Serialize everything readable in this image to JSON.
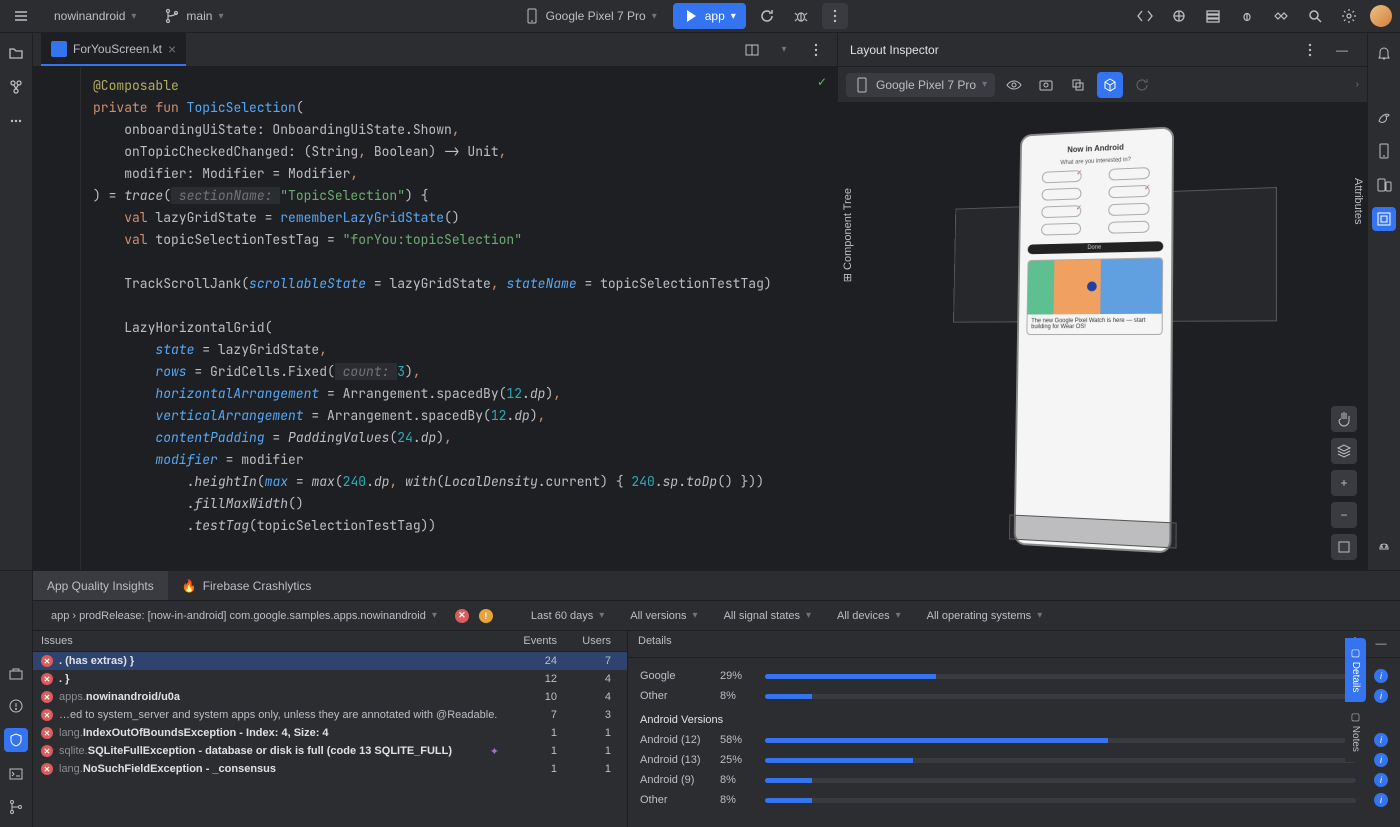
{
  "topbar": {
    "project": "nowinandroid",
    "branch": "main",
    "device": "Google Pixel 7 Pro",
    "run_config": "app"
  },
  "editor": {
    "tab_name": "ForYouScreen.kt",
    "code": {
      "l1": "@Composable",
      "l2a": "private",
      "l2b": "fun",
      "l2c": "TopicSelection",
      "l2d": "(",
      "l3a": "onboardingUiState",
      "l3b": ": OnboardingUiState.Shown",
      "l3c": ",",
      "l4a": "onTopicCheckedChanged",
      "l4b": ": (String",
      "l4c": ",",
      "l4d": " Boolean) -> Unit",
      "l4e": ",",
      "l5a": "modifier",
      "l5b": ": Modifier = Modifier",
      "l5c": ",",
      "l6a": ") = ",
      "l6b": "trace",
      "l6c": "(",
      "l6hint": " sectionName: ",
      "l6d": "\"TopicSelection\"",
      "l6e": ") {",
      "l7a": "val",
      "l7b": " lazyGridState = ",
      "l7c": "rememberLazyGridState",
      "l7d": "()",
      "l8a": "val",
      "l8b": " topicSelectionTestTag = ",
      "l8c": "\"forYou:topicSelection\"",
      "l10a": "TrackScrollJank(",
      "l10b": "scrollableState",
      "l10c": " = lazyGridState",
      "l10d": ",",
      "l10e": " stateName",
      "l10f": " = topicSelectionTestTag)",
      "l12a": "LazyHorizontalGrid(",
      "l13a": "state",
      "l13b": " = lazyGridState",
      "l13c": ",",
      "l14a": "rows",
      "l14b": " = GridCells.Fixed(",
      "l14hint": " count: ",
      "l14c": "3",
      "l14d": ")",
      "l14e": ",",
      "l15a": "horizontalArrangement",
      "l15b": " = Arrangement.spacedBy(",
      "l15c": "12",
      "l15d": ".",
      "l15e": "dp",
      "l15f": ")",
      "l15g": ",",
      "l16a": "verticalArrangement",
      "l16b": " = Arrangement.spacedBy(",
      "l16c": "12",
      "l16d": ".",
      "l16e": "dp",
      "l16f": ")",
      "l16g": ",",
      "l17a": "contentPadding",
      "l17b": " = ",
      "l17c": "PaddingValues",
      "l17d": "(",
      "l17e": "24",
      "l17f": ".",
      "l17g": "dp",
      "l17h": ")",
      "l17i": ",",
      "l18a": "modifier",
      "l18b": " = modifier",
      "l19a": ".",
      "l19b": "heightIn",
      "l19c": "(",
      "l19d": "max",
      "l19e": " = ",
      "l19f": "max",
      "l19g": "(",
      "l19h": "240",
      "l19i": ".",
      "l19j": "dp",
      "l19k": ",",
      "l19l": " with",
      "l19m": "(",
      "l19n": "LocalDensity",
      "l19o": ".current) { ",
      "l19p": "240",
      "l19q": ".",
      "l19r": "sp",
      "l19s": ".",
      "l19t": "toDp",
      "l19u": "() }))",
      "l20a": ".",
      "l20b": "fillMaxWidth",
      "l20c": "()",
      "l21a": ".",
      "l21b": "testTag",
      "l21c": "(topicSelectionTestTag))"
    }
  },
  "inspector": {
    "title": "Layout Inspector",
    "device": "Google Pixel 7 Pro",
    "component_tree_label": "Component Tree",
    "attributes_label": "Attributes",
    "phone": {
      "title": "Now in Android",
      "subtitle": "What are you interested in?",
      "done": "Done",
      "card_text": "The new Google Pixel Watch is here — start building for Wear OS!"
    }
  },
  "bottom": {
    "tabs": {
      "aqi": "App Quality Insights",
      "crashlytics": "Firebase Crashlytics"
    },
    "breadcrumb": "app › prodRelease: [now-in-android] com.google.samples.apps.nowinandroid",
    "filters": {
      "time": "Last 60 days",
      "versions": "All versions",
      "signal": "All signal states",
      "devices": "All devices",
      "os": "All operating systems"
    },
    "headers": {
      "issues": "Issues",
      "events": "Events",
      "users": "Users",
      "details": "Details"
    },
    "issues": [
      {
        "pre": "",
        "bold": ". (has extras) }",
        "events": "24",
        "users": "7"
      },
      {
        "pre": "",
        "bold": ". }",
        "events": "12",
        "users": "4"
      },
      {
        "pre": "apps.",
        "bold": "nowinandroid/u0a",
        "events": "10",
        "users": "4"
      },
      {
        "pre": "",
        "bold": "…ed to system_server and system apps only, unless they are annotated with @Readable.",
        "events": "7",
        "users": "3"
      },
      {
        "pre": "lang.",
        "bold": "IndexOutOfBoundsException - Index: 4, Size: 4",
        "events": "1",
        "users": "1"
      },
      {
        "pre": "sqlite.",
        "bold": "SQLiteFullException - database or disk is full (code 13 SQLITE_FULL)",
        "events": "1",
        "users": "1"
      },
      {
        "pre": "lang.",
        "bold": "NoSuchFieldException - _consensus",
        "events": "1",
        "users": "1"
      }
    ],
    "details": {
      "devices": [
        {
          "label": "Google",
          "pct": "29%",
          "w": "29%"
        },
        {
          "label": "Other",
          "pct": "8%",
          "w": "8%"
        }
      ],
      "android_title": "Android Versions",
      "android": [
        {
          "label": "Android (12)",
          "pct": "58%",
          "w": "58%"
        },
        {
          "label": "Android (13)",
          "pct": "25%",
          "w": "25%"
        },
        {
          "label": "Android (9)",
          "pct": "8%",
          "w": "8%"
        },
        {
          "label": "Other",
          "pct": "8%",
          "w": "8%"
        }
      ]
    },
    "side_tabs": {
      "details": "Details",
      "notes": "Notes"
    }
  }
}
